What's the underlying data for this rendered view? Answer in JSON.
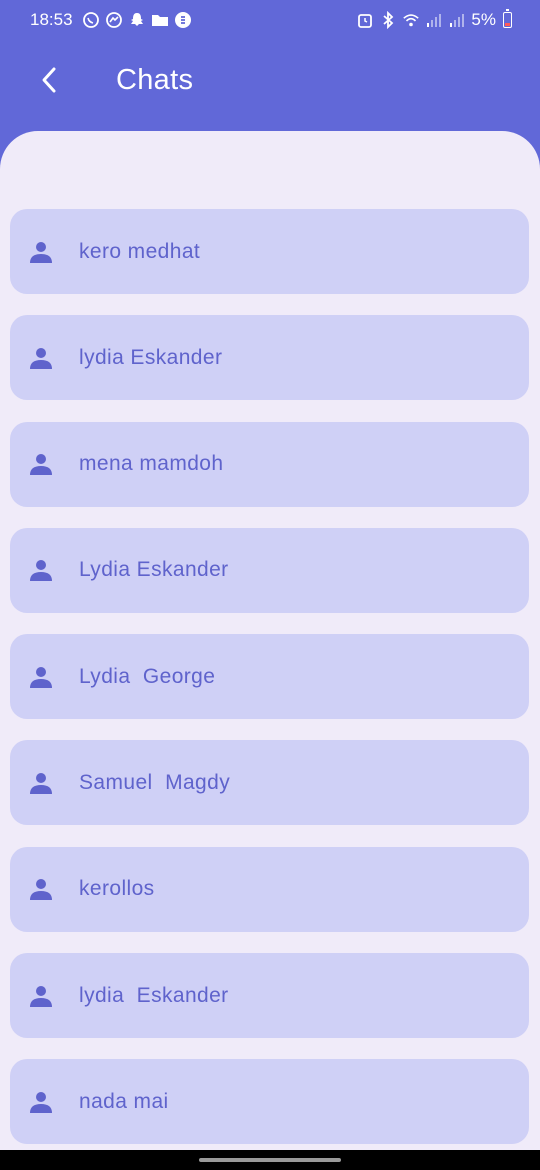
{
  "status_bar": {
    "time": "18:53",
    "battery": "5%",
    "left_icons": [
      "whatsapp-icon",
      "messenger-icon",
      "snapchat-icon",
      "folder-icon",
      "shazam-icon"
    ],
    "right_icons": [
      "alarm-icon",
      "bluetooth-icon",
      "wifi-icon",
      "signal-icon",
      "signal-icon"
    ]
  },
  "app_bar": {
    "title": "Chats",
    "back_icon": "chevron-left-icon"
  },
  "chats": [
    {
      "name": "kero medhat"
    },
    {
      "name": "lydia Eskander"
    },
    {
      "name": "mena mamdoh"
    },
    {
      "name": "Lydia Eskander"
    },
    {
      "name": "Lydia  George"
    },
    {
      "name": "Samuel  Magdy"
    },
    {
      "name": "kerollos"
    },
    {
      "name": "lydia  Eskander"
    },
    {
      "name": "nada mai"
    }
  ],
  "colors": {
    "header": "#6168d8",
    "background": "#f0ebf9",
    "card": "#cfd0f6",
    "accent": "#5f63cc"
  }
}
